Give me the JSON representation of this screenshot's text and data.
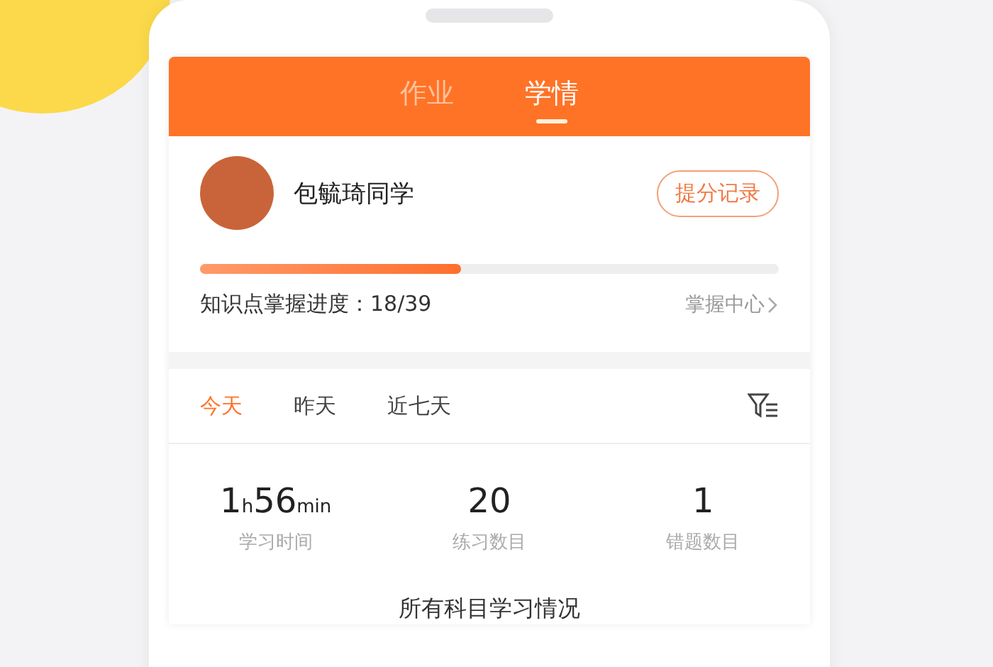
{
  "tabs": [
    {
      "label": "作业",
      "selected": false
    },
    {
      "label": "学情",
      "selected": true
    }
  ],
  "student": {
    "name": "包毓琦同学",
    "button": "提分记录"
  },
  "progress": {
    "level": 0.45,
    "label": "知识点掌握进度：18/39",
    "link": "掌握中心"
  },
  "periods": [
    {
      "label": "今天",
      "selected": true
    },
    {
      "label": "昨天",
      "selected": false
    },
    {
      "label": "近七天",
      "selected": false
    }
  ],
  "stats": [
    {
      "value": [
        {
          "text": "1",
          "kind": "number"
        },
        {
          "text": "h",
          "kind": "unit"
        },
        {
          "text": "56",
          "kind": "number"
        },
        {
          "text": "min",
          "kind": "unit"
        }
      ],
      "label": "学习时间"
    },
    {
      "value": [
        {
          "text": "20",
          "kind": "number"
        }
      ],
      "label": "练习数目"
    },
    {
      "value": [
        {
          "text": "1",
          "kind": "number"
        }
      ],
      "label": "错题数目"
    }
  ],
  "section_title": "所有科目学习情况"
}
